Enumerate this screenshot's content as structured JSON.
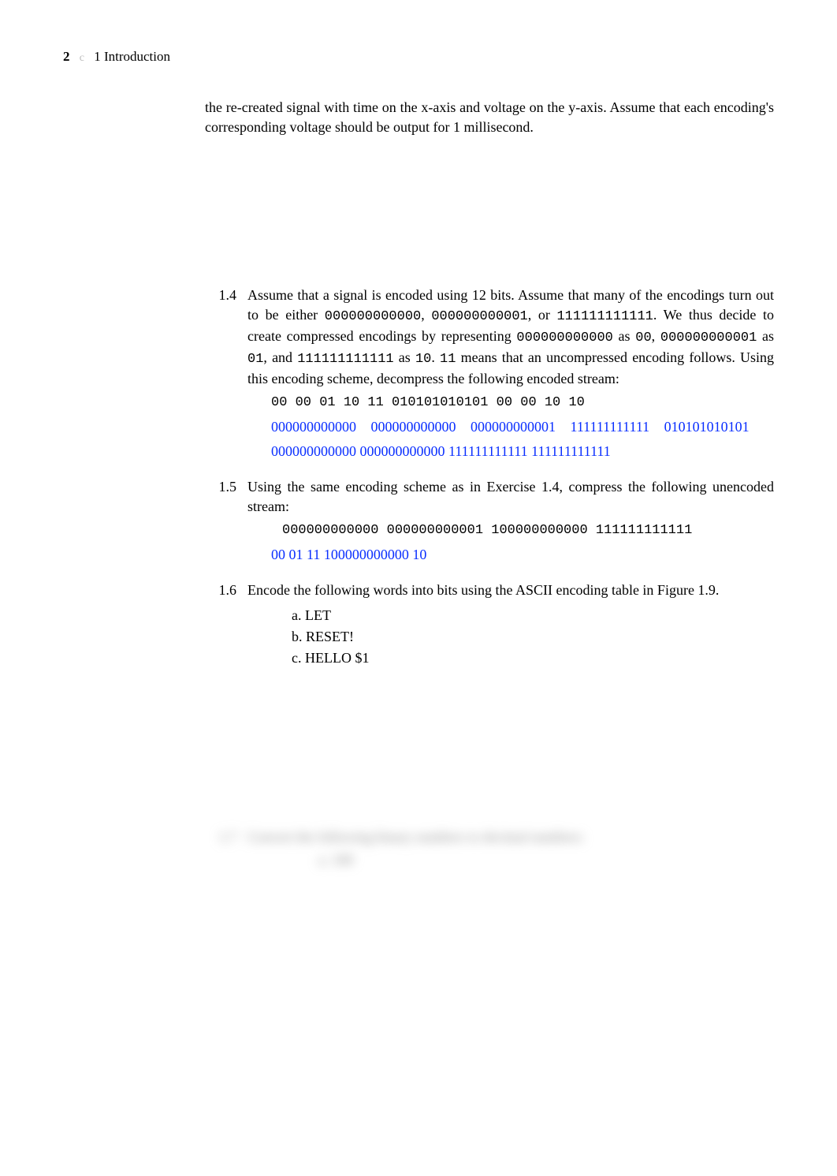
{
  "header": {
    "pageNumber": "2",
    "separator": "c",
    "chapterLabel": "1  Introduction"
  },
  "introParagraph": "the re-created signal with time on the x-axis and voltage on the y-axis. Assume that each encoding's corresponding voltage should be output for 1 millisecond.",
  "ex14": {
    "num": "1.4",
    "text1": "Assume that a signal is encoded using 12 bits. Assume that many of the encodings turn out to be either ",
    "code1": "000000000000",
    "sep1": ", ",
    "code2": "000000000001",
    "sep2": ", or ",
    "code3": "111111111111",
    "text2": ". We thus decide to create compressed encodings by representing ",
    "code4": "000000000000",
    "text3": " as ",
    "code5": "00",
    "sep3": ", ",
    "code6": "000000000001",
    "text4": " as ",
    "code7": "01",
    "text5": ", and ",
    "code8": "111111111111",
    "text6": " as ",
    "code9": "10",
    "period1": ". ",
    "code10": "11",
    "text7": " means that an uncompressed encoding follows. Using this encoding scheme, decompress the following encoded stream:",
    "codeLine": "00 00 01 10 11 010101010101 00 00 10 10",
    "answerA": "000000000000   000000000000   000000000001   111111111111   010101010101",
    "answerB": "000000000000 000000000000 111111111111 111111111111"
  },
  "ex15": {
    "num": "1.5",
    "text": "Using the same encoding scheme as in Exercise 1.4, compress the following unencoded stream:",
    "codeLine": "000000000000 000000000001 100000000000 111111111111",
    "answer": "00 01 11 100000000000 10"
  },
  "ex16": {
    "num": "1.6",
    "text": "Encode the following words into bits using the ASCII encoding table in Figure 1.9.",
    "a": "a.  LET",
    "b": "b.  RESET!",
    "c": "c.  HELLO $1"
  },
  "blurred": {
    "num": "1.7",
    "text": "Convert the following binary numbers to decimal numbers:",
    "a": "a. 100"
  }
}
